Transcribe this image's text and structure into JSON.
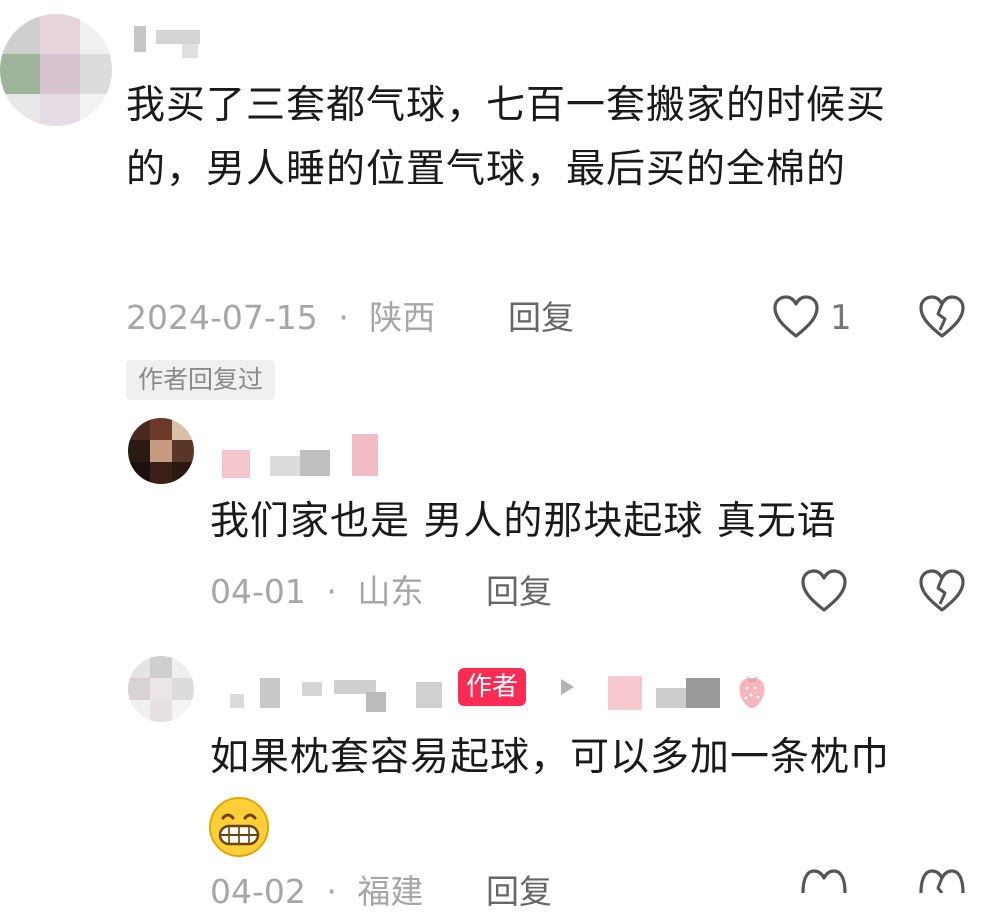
{
  "comments": [
    {
      "text": "我买了三套都气球，七百一套搬家的时候买的，男人睡的位置气球，最后买的全棉的",
      "date": "2024-07-15",
      "location": "陕西",
      "reply_label": "回复",
      "like_count": "1",
      "author_replied_tag": "作者回复过",
      "separator": "·"
    },
    {
      "text": "我们家也是 男人的那块起球 真无语",
      "date": "04-01",
      "location": "山东",
      "reply_label": "回复",
      "separator": "·"
    },
    {
      "author_badge": "作者",
      "text": "如果枕套容易起球，可以多加一条枕巾",
      "emoji": "😁",
      "date": "04-02",
      "location": "福建",
      "reply_label": "回复",
      "separator": "·"
    }
  ],
  "icons": [
    "heart-outline-icon",
    "broken-heart-icon",
    "reply-arrow-icon",
    "strawberry-icon",
    "grin-emoji-icon"
  ],
  "colors": {
    "text": "#1a1a1a",
    "meta": "#a6a6a6",
    "accent": "#fe2c55"
  }
}
